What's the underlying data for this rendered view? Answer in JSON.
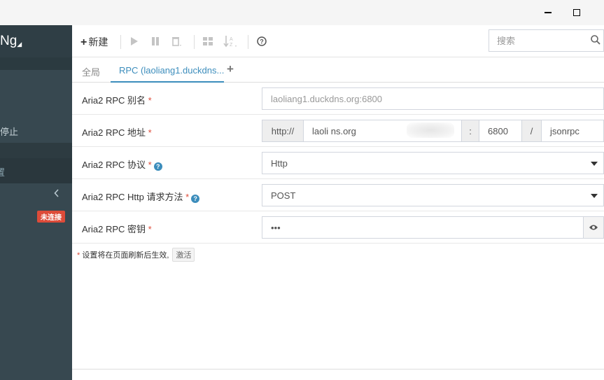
{
  "sidebar": {
    "brand": "Ng",
    "brand_sub": "◢",
    "item_stopped": "停止",
    "item_settings_partial": "置",
    "collapse_icon": "chevron-left-icon",
    "status_badge": "未连接"
  },
  "toolbar": {
    "new_label": "新建",
    "search_placeholder": "搜索"
  },
  "tabs": {
    "global": "全局",
    "rpc": "RPC (laoliang1.duckdns...",
    "add": "+"
  },
  "form": {
    "alias": {
      "label": "Aria2 RPC 别名",
      "value": "laoliang1.duckdns.org:6800"
    },
    "address": {
      "label": "Aria2 RPC 地址",
      "protocol": "http://",
      "host": "laoli            ns.org",
      "colon": ":",
      "port": "6800",
      "slash": "/",
      "interface": "jsonrpc"
    },
    "protocol": {
      "label": "Aria2 RPC 协议",
      "value": "Http"
    },
    "method": {
      "label": "Aria2 RPC Http 请求方法",
      "value": "POST"
    },
    "secret": {
      "label": "Aria2 RPC 密钥",
      "value": "•••"
    },
    "required_mark": "*"
  },
  "note": {
    "text": "设置将在页面刷新后生效,",
    "activate": "激活"
  },
  "colors": {
    "accent": "#3c8dbc",
    "danger": "#dd4b39",
    "sidebar": "#374850"
  }
}
